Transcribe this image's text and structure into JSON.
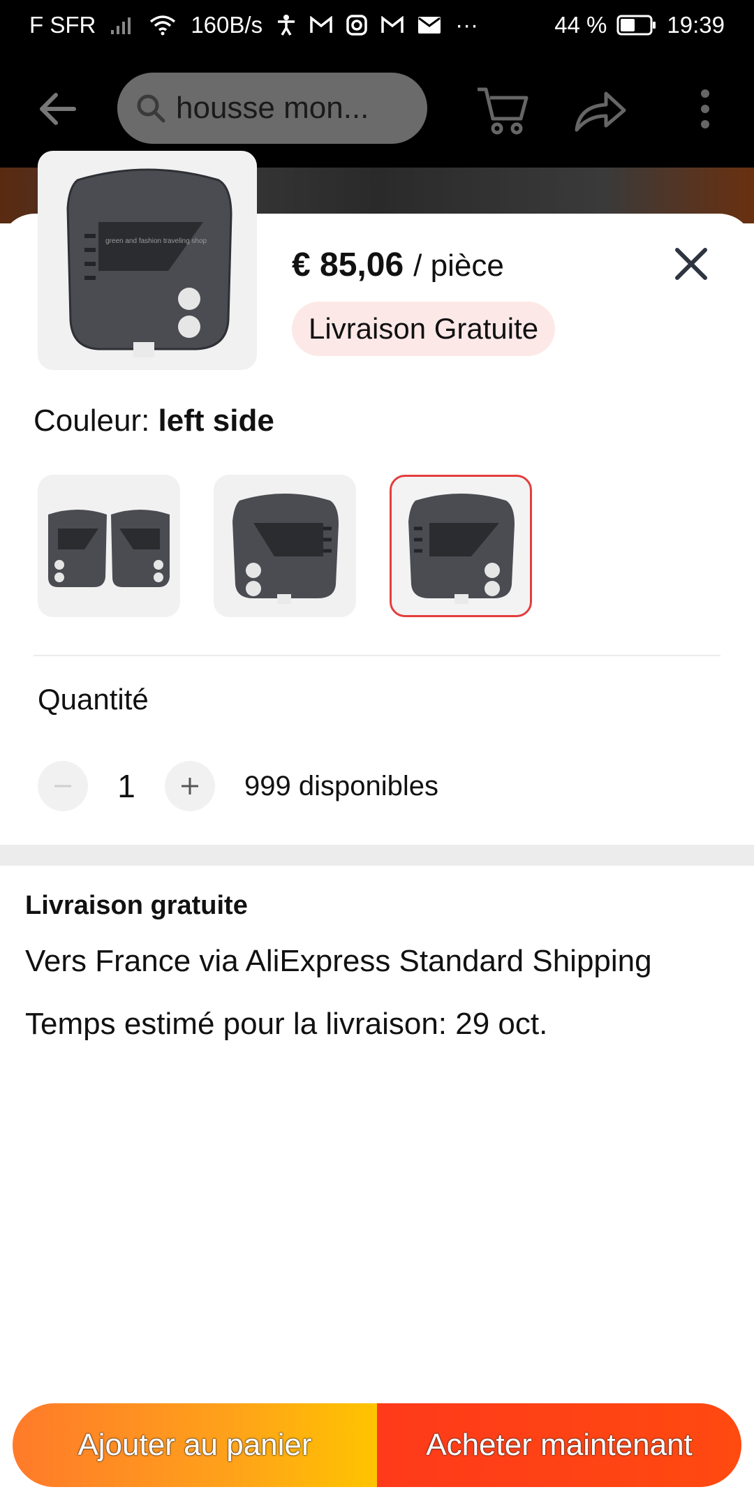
{
  "status_bar": {
    "carrier": "F SFR",
    "speed": "160B/s",
    "battery": "44 %",
    "time": "19:39",
    "icons": [
      "signal-icon",
      "wifi-icon",
      "accessibility-icon",
      "gmail-icon",
      "instagram-icon",
      "gmail-icon",
      "mail-icon",
      "more-dots-icon",
      "battery-icon"
    ],
    "overflow": "···"
  },
  "app_bar": {
    "search_text": "housse mon...",
    "icons": [
      "back-arrow-icon",
      "search-icon",
      "cart-icon",
      "share-icon",
      "more-vertical-icon"
    ]
  },
  "sheet": {
    "price": "€ 85,06",
    "unit": "/ pièce",
    "badge": "Livraison Gratuite",
    "color_label": "Couleur: ",
    "color_value": "left side",
    "variants": [
      {
        "name": "pair",
        "selected": false
      },
      {
        "name": "right side",
        "selected": false
      },
      {
        "name": "left side",
        "selected": true
      }
    ],
    "watermark": "green and fashion traveling shop",
    "quantity_label": "Quantité",
    "quantity_value": "1",
    "available": "999 disponibles",
    "shipping_title": "Livraison gratuite",
    "shipping_line1": "Vers France via AliExpress Standard Shipping",
    "shipping_line2": "Temps estimé pour la livraison: 29 oct."
  },
  "buttons": {
    "add_to_cart": "Ajouter au panier",
    "buy_now": "Acheter maintenant"
  },
  "colors": {
    "accent_red": "#e43d3d",
    "badge_bg": "#fde8e8",
    "add_cart_gradient": [
      "#ff7a2a",
      "#ffc400"
    ],
    "buy_now": "#ff4014"
  }
}
